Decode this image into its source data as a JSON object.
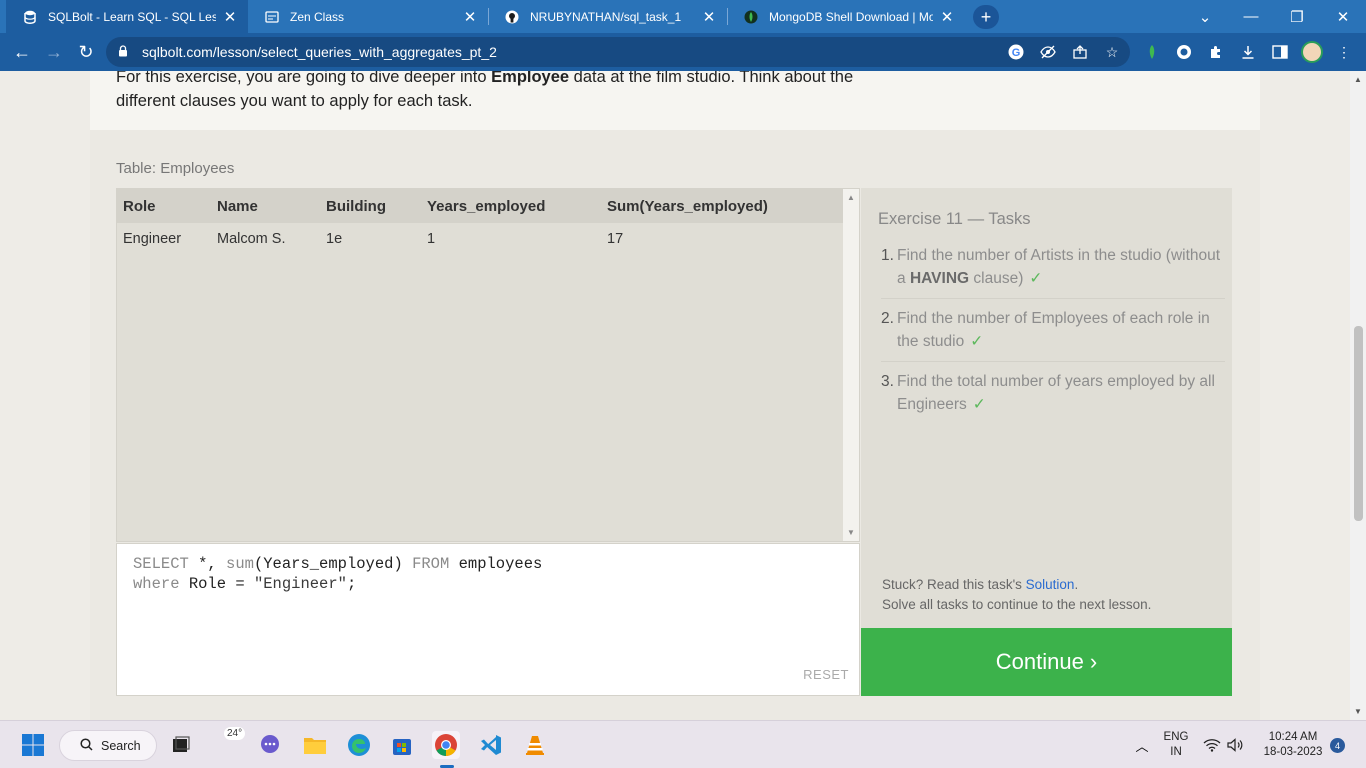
{
  "browser": {
    "tabs": [
      {
        "title": "SQLBolt - Learn SQL - SQL Lesson",
        "icon": "db-icon"
      },
      {
        "title": "Zen Class",
        "icon": "zen-icon"
      },
      {
        "title": "NRUBYNATHAN/sql_task_1",
        "icon": "github-icon"
      },
      {
        "title": "MongoDB Shell Download | Mon",
        "icon": "mongodb-leaf-icon"
      }
    ],
    "url": "sqlbolt.com/lesson/select_queries_with_aggregates_pt_2"
  },
  "page": {
    "intro_pre": "For this exercise, you are going to dive deeper into ",
    "intro_bold": "Employee",
    "intro_post": " data at the film studio. Think about the different clauses you want to apply for each task.",
    "table_caption": "Table: Employees",
    "result": {
      "columns": [
        "Role",
        "Name",
        "Building",
        "Years_employed",
        "Sum(Years_employed)"
      ],
      "rows": [
        [
          "Engineer",
          "Malcom S.",
          "1e",
          "1",
          "17"
        ]
      ]
    },
    "query": {
      "l1_kw1": "SELECT",
      "l1_mid": " *, ",
      "l1_fn": "sum",
      "l1_args": "(Years_employed) ",
      "l1_kw2": "FROM",
      "l1_tail": " employees",
      "l2_kw": "where",
      "l2_mid": " Role =  ",
      "l2_str": "\"Engineer\"",
      "l2_tail": ";"
    },
    "reset_label": "RESET",
    "exercise_title": "Exercise 11 — Tasks",
    "tasks": [
      {
        "num": "1.",
        "pre": "Find the number of Artists in the studio (without a ",
        "bold": "HAVING",
        "post": " clause)",
        "check": "✓"
      },
      {
        "num": "2.",
        "pre": "Find the number of Employees of each role in the studio",
        "bold": "",
        "post": "",
        "check": "✓"
      },
      {
        "num": "3.",
        "pre": "Find the total number of years employed by all Engineers",
        "bold": "",
        "post": "",
        "check": "✓"
      }
    ],
    "stuck_pre": "Stuck? Read this task's ",
    "stuck_link": "Solution",
    "stuck_post": ".",
    "solve_text": "Solve all tasks to continue to the next lesson.",
    "continue_label": "Continue ›"
  },
  "taskbar": {
    "search_label": "Search",
    "weather": "24°",
    "lang_top": "ENG",
    "lang_bottom": "IN",
    "time": "10:24 AM",
    "date": "18-03-2023",
    "notifications": "4"
  },
  "colors": {
    "accent_green": "#3cb24b",
    "chrome_blue": "#1d5da0",
    "link_blue": "#2a6bd0"
  }
}
